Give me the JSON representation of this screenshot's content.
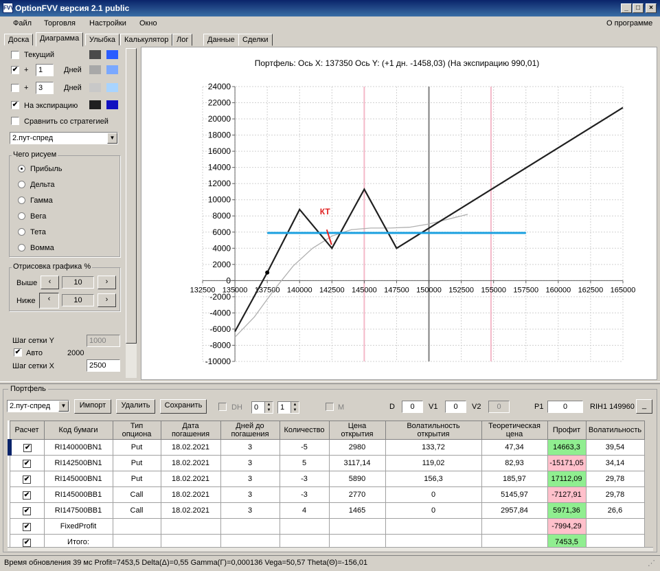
{
  "window": {
    "title": "OptionFVV версия 2.1 public",
    "icon": "FVV"
  },
  "menu": {
    "items": [
      "Файл",
      "Торговля",
      "Настройки",
      "Окно"
    ],
    "about": "О программе"
  },
  "tabs": [
    "Доска",
    "Диаграмма",
    "Улыбка",
    "Калькулятор",
    "Лог",
    "Данные",
    "Сделки"
  ],
  "left": {
    "current": "Текущий",
    "plus": "+",
    "days_label": "Дней",
    "days1": "1",
    "days2": "3",
    "expiration": "На экспирацию",
    "compare": "Сравнить со стратегией",
    "strategy": "2.пут-спред",
    "what_title": "Чего рисуем",
    "radios": [
      "Прибыль",
      "Дельта",
      "Гамма",
      "Вега",
      "Тета",
      "Вомма"
    ],
    "draw_title": "Отрисовка графика %",
    "above": "Выше",
    "below": "Ниже",
    "above_val": "10",
    "below_val": "10",
    "grid_y_label": "Шаг сетки Y",
    "grid_y_val": "1000",
    "auto": "Авто",
    "auto_val": "2000",
    "grid_x_label": "Шаг сетки X",
    "grid_x_val": "2500",
    "colors": {
      "current": [
        "#4a4a4a",
        "#2a5cff"
      ],
      "day1": [
        "#a8a8a8",
        "#7aa8ff"
      ],
      "day3": [
        "#c8c8c8",
        "#a8d4ff"
      ],
      "exp": [
        "#202020",
        "#1010c0"
      ]
    }
  },
  "chart_data": {
    "type": "line",
    "title": "Портфель:  Ось X:  137350  Ось Y:   (+1 дн.  -1458,03)   (На экспирацию  990,01)",
    "xlim": [
      132500,
      165000
    ],
    "ylim": [
      -10000,
      24000
    ],
    "x_ticks": [
      "132500",
      "135000",
      "137500",
      "140000",
      "142500",
      "145000",
      "147500",
      "150000",
      "152500",
      "155000",
      "157500",
      "160000",
      "162500",
      "165000"
    ],
    "y_ticks": [
      "24000",
      "22000",
      "20000",
      "18000",
      "16000",
      "14000",
      "12000",
      "10000",
      "8000",
      "6000",
      "4000",
      "2000",
      "0",
      "-2000",
      "-4000",
      "-6000",
      "-8000",
      "-10000"
    ],
    "series": [
      {
        "color": "#202020",
        "x": [
          135000,
          137500,
          140000,
          142500,
          145000,
          147500,
          165000
        ],
        "y": [
          -6300,
          1000,
          8800,
          4000,
          11300,
          4000,
          21400
        ]
      },
      {
        "color": "#b0b0b0",
        "x": [
          135000,
          136500,
          138000,
          139500,
          141000,
          142500,
          144000,
          145500,
          147000,
          148500,
          150000,
          151500,
          153000
        ],
        "y": [
          -7000,
          -4500,
          -1200,
          1800,
          4000,
          5500,
          6300,
          6500,
          6500,
          6600,
          7000,
          7600,
          8200
        ]
      }
    ],
    "level_line": {
      "y": 5900,
      "x": [
        137500,
        157500
      ],
      "color": "#1aa0e0"
    },
    "vlines": [
      {
        "x": 145000,
        "color": "#f4b8c8"
      },
      {
        "x": 150000,
        "color": "#808080"
      },
      {
        "x": 154800,
        "color": "#f4b8c8"
      }
    ],
    "marker": {
      "x": 137500,
      "y": 1000
    },
    "kt": {
      "label": "КТ",
      "x": 142100,
      "y": 6300
    }
  },
  "portfolio": {
    "title": "Портфель",
    "strategy": "2.пут-спред",
    "import": "Импорт",
    "delete": "Удалить",
    "save": "Сохранить",
    "dh": "DH",
    "dh_a": "0",
    "dh_b": "1",
    "m": "M",
    "d_label": "D",
    "d_val": "0",
    "v1_label": "V1",
    "v1_val": "0",
    "v2_label": "V2",
    "v2_val": "0",
    "p1_label": "P1",
    "p1_val": "0",
    "ticker": "RIH1 149960",
    "ticker_btn": "_",
    "headers": [
      "Расчет",
      "Код бумаги",
      "Тип\nопциона",
      "Дата\nпогашения",
      "Дней до\nпогашения",
      "Количество",
      "Цена\nоткрытия",
      "Волатильность\nоткрытия",
      "Теоретическая\nцена",
      "Профит",
      "Волатильность"
    ],
    "rows": [
      [
        "✔",
        "RI140000BN1",
        "Put",
        "18.02.2021",
        "3",
        "-5",
        "2980",
        "133,72",
        "47,34",
        "14663,3",
        "39,54"
      ],
      [
        "✔",
        "RI142500BN1",
        "Put",
        "18.02.2021",
        "3",
        "5",
        "3117,14",
        "119,02",
        "82,93",
        "-15171,05",
        "34,14"
      ],
      [
        "✔",
        "RI145000BN1",
        "Put",
        "18.02.2021",
        "3",
        "-3",
        "5890",
        "156,3",
        "185,97",
        "17112,09",
        "29,78"
      ],
      [
        "✔",
        "RI145000BB1",
        "Call",
        "18.02.2021",
        "3",
        "-3",
        "2770",
        "0",
        "5145,97",
        "-7127,91",
        "29,78"
      ],
      [
        "✔",
        "RI147500BB1",
        "Call",
        "18.02.2021",
        "3",
        "4",
        "1465",
        "0",
        "2957,84",
        "5971,36",
        "26,6"
      ],
      [
        "✔",
        "FixedProfit",
        "",
        "",
        "",
        "",
        "",
        "",
        "",
        "-7994,29",
        ""
      ],
      [
        "✔",
        "Итого:",
        "",
        "",
        "",
        "",
        "",
        "",
        "",
        "7453,5",
        ""
      ]
    ],
    "profit_colors": [
      "#90ee90",
      "#ffc0cb",
      "#90ee90",
      "#ffc0cb",
      "#90ee90",
      "#ffc0cb",
      "#90ee90"
    ]
  },
  "status": "Время обновления 39 мс  Profit=7453,5 Delta(Δ)=0,55 Gamma(Γ)=0,000136 Vega=50,57 Theta(Θ)=-156,01"
}
